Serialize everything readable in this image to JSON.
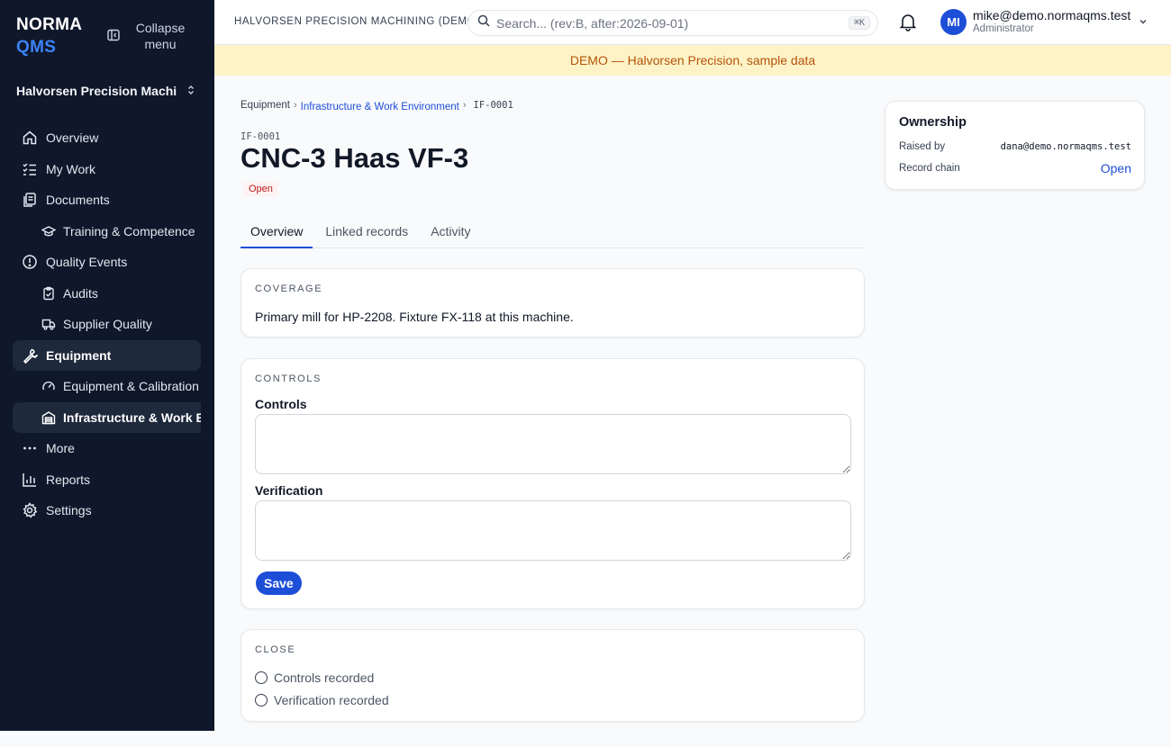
{
  "brand": {
    "line1": "NORMA",
    "line2": "QMS"
  },
  "sidebar": {
    "collapse_label": "Collapse menu",
    "org_name": "Halvorsen Precision Machining",
    "items": [
      {
        "label": "Overview",
        "icon": "home-icon"
      },
      {
        "label": "My Work",
        "icon": "checklist-icon"
      },
      {
        "label": "Documents",
        "icon": "documents-icon"
      },
      {
        "label": "Training & Competence",
        "icon": "graduation-cap-icon"
      },
      {
        "label": "Quality Events",
        "icon": "alert-circle-icon"
      },
      {
        "label": "Audits",
        "icon": "clipboard-check-icon"
      },
      {
        "label": "Supplier Quality",
        "icon": "truck-icon"
      },
      {
        "label": "Equipment",
        "icon": "wrench-icon"
      },
      {
        "label": "Equipment & Calibration",
        "icon": "gauge-icon"
      },
      {
        "label": "Infrastructure & Work Environment",
        "icon": "warehouse-icon"
      },
      {
        "label": "More",
        "icon": "more-dots-icon"
      },
      {
        "label": "Reports",
        "icon": "bar-chart-icon"
      },
      {
        "label": "Settings",
        "icon": "gear-icon"
      }
    ]
  },
  "topbar": {
    "tenant": "HALVORSEN PRECISION MACHINING (DEMO)",
    "search_placeholder": "Search... (rev:B, after:2026-09-01)",
    "search_shortcut": "⌘K",
    "user_initials": "MI",
    "user_email": "mike@demo.normaqms.test",
    "user_role": "Administrator"
  },
  "banner": "DEMO — Halvorsen Precision, sample data",
  "breadcrumb": {
    "root": "Equipment",
    "section": "Infrastructure & Work Environment",
    "current": "IF-0001"
  },
  "record": {
    "id": "IF-0001",
    "title": "CNC-3 Haas VF-3",
    "status": "Open"
  },
  "tabs": [
    "Overview",
    "Linked records",
    "Activity"
  ],
  "coverage": {
    "heading": "COVERAGE",
    "text": "Primary mill for HP-2208. Fixture FX-118 at this machine."
  },
  "controls": {
    "heading": "CONTROLS",
    "controls_label": "Controls",
    "controls_value": "",
    "verification_label": "Verification",
    "verification_value": "",
    "save_label": "Save"
  },
  "close": {
    "heading": "CLOSE",
    "checks": [
      "Controls recorded",
      "Verification recorded"
    ]
  },
  "ownership": {
    "title": "Ownership",
    "raised_by_label": "Raised by",
    "raised_by_value": "dana@demo.normaqms.test",
    "record_chain_label": "Record chain",
    "record_chain_link": "Open"
  },
  "colors": {
    "sidebar_bg": "#0f172a",
    "accent": "#1d4ed8",
    "banner_bg": "#fef3c7",
    "banner_text": "#b45309",
    "status_open": "#b91c1c"
  }
}
